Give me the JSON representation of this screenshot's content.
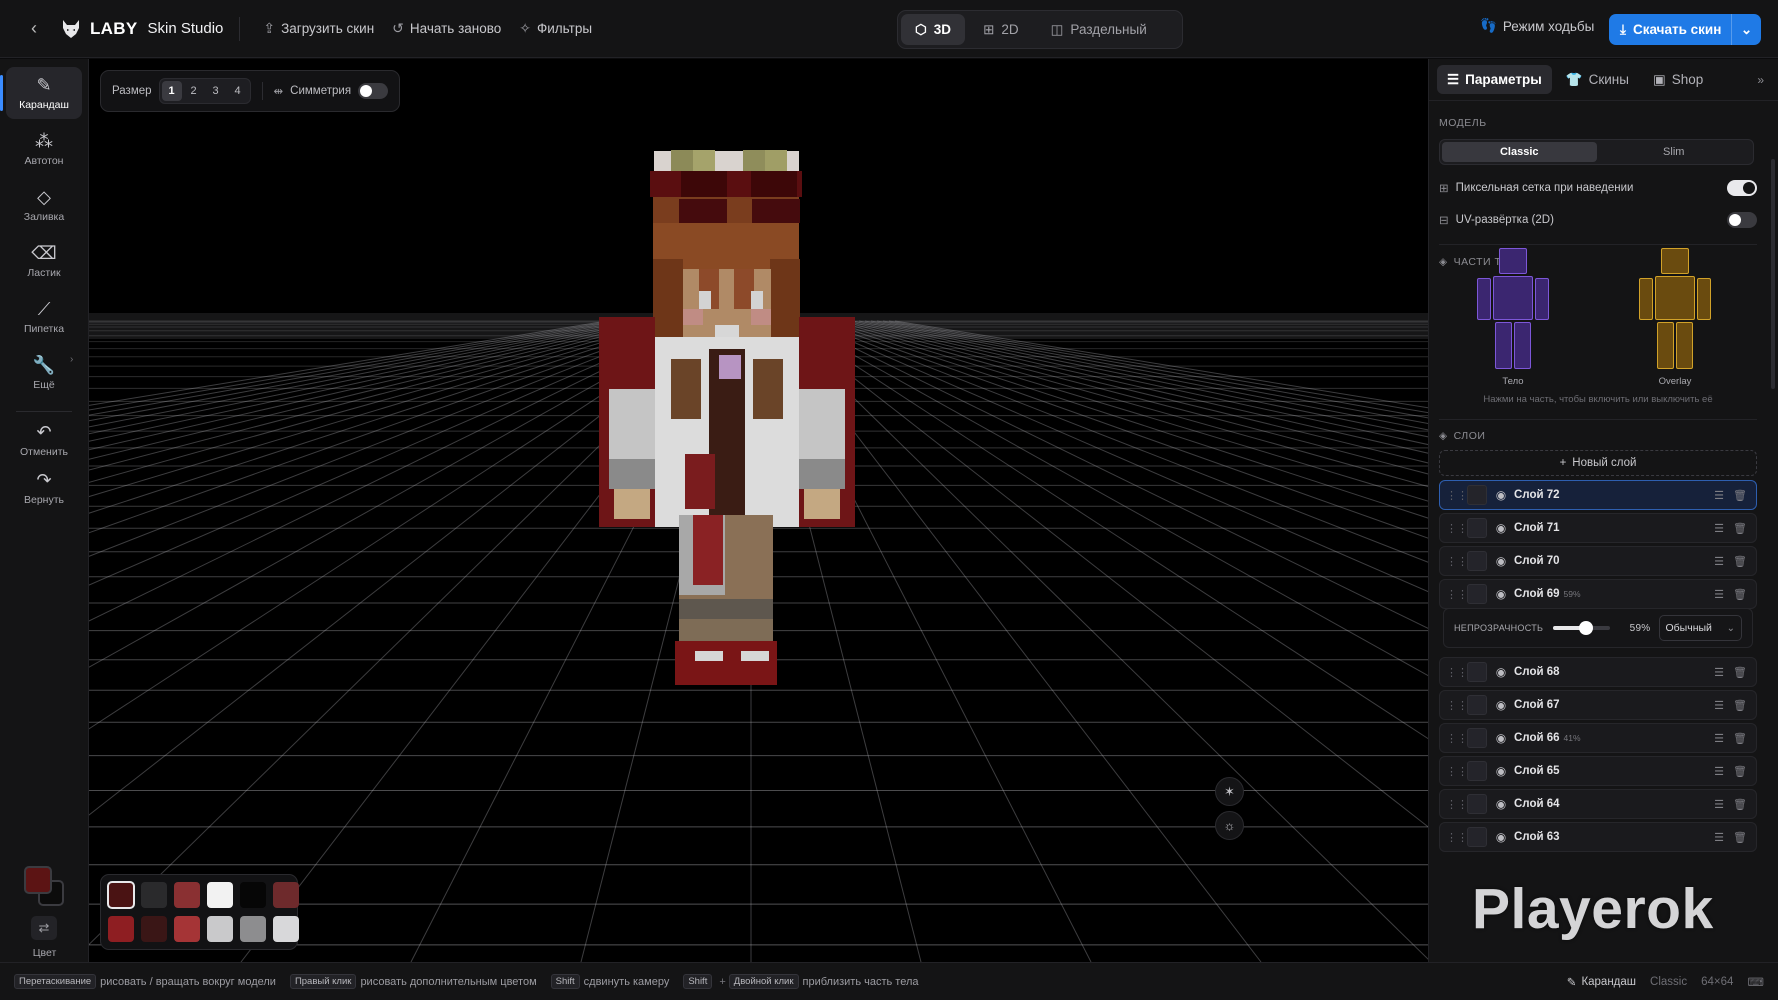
{
  "topbar": {
    "logo_brand": "LABY",
    "logo_sub": "Skin Studio",
    "actions": [
      {
        "label": "Загрузить скин",
        "icon": "upload-icon"
      },
      {
        "label": "Начать заново",
        "icon": "reset-icon"
      },
      {
        "label": "Фильтры",
        "icon": "wand-icon"
      }
    ],
    "views": [
      {
        "label": "3D",
        "icon": "cube-icon",
        "active": true
      },
      {
        "label": "2D",
        "icon": "grid-icon",
        "active": false
      },
      {
        "label": "Раздельный",
        "icon": "split-icon",
        "active": false
      }
    ],
    "walk_mode": "Режим ходьбы",
    "download": "Скачать скин"
  },
  "tools": [
    {
      "label": "Карандаш",
      "icon": "pencil-icon",
      "active": true
    },
    {
      "label": "Автотон",
      "icon": "spray-icon"
    },
    {
      "label": "Заливка",
      "icon": "bucket-icon"
    },
    {
      "label": "Ластик",
      "icon": "eraser-icon"
    },
    {
      "label": "Пипетка",
      "icon": "eyedropper-icon"
    },
    {
      "label": "Ещё",
      "icon": "wrench-icon"
    },
    {
      "label": "Отменить",
      "icon": "undo-icon"
    },
    {
      "label": "Вернуть",
      "icon": "redo-icon"
    }
  ],
  "color": {
    "label": "Цвет",
    "primary": "#5c1414",
    "secondary": "#0c0c0c"
  },
  "brush": {
    "size_label": "Размер",
    "sizes": [
      "1",
      "2",
      "3",
      "4"
    ],
    "active_size": "1",
    "symmetry_label": "Симметрия",
    "symmetry_on": false
  },
  "palette": [
    "#4a1313",
    "#2a2a2c",
    "#8a3032",
    "#f2f2f2",
    "#060606",
    "#6e2a2c",
    "#8e1e22",
    "#3a1616",
    "#a53436",
    "#c9c9cb",
    "#8d8d8f",
    "#d8d8da"
  ],
  "right_panel": {
    "tabs": [
      {
        "label": "Параметры",
        "icon": "sliders-icon",
        "active": true
      },
      {
        "label": "Скины",
        "icon": "shirt-icon",
        "active": false
      },
      {
        "label": "Shop",
        "icon": "shop-icon",
        "active": false
      }
    ],
    "model_title": "МОДЕЛЬ",
    "model_options": [
      "Classic",
      "Slim"
    ],
    "model_active": "Classic",
    "pixel_grid_label": "Пиксельная сетка при наведении",
    "pixel_grid_on": true,
    "uv_label": "UV-развёртка (2D)",
    "uv_on": false,
    "body_parts_title": "ЧАСТИ ТЕЛА",
    "body_label": "Тело",
    "overlay_label": "Overlay",
    "body_parts_hint": "Нажми на часть, чтобы включить или выключить её",
    "layers_title": "СЛОИ",
    "new_layer": "Новый слой",
    "layers": [
      {
        "name": "Слой 72",
        "pct": "",
        "selected": true
      },
      {
        "name": "Слой 71",
        "pct": ""
      },
      {
        "name": "Слой 70",
        "pct": ""
      },
      {
        "name": "Слой 69",
        "pct": "59%"
      },
      {
        "name": "Слой 68",
        "pct": ""
      },
      {
        "name": "Слой 67",
        "pct": ""
      },
      {
        "name": "Слой 66",
        "pct": "41%"
      },
      {
        "name": "Слой 65",
        "pct": ""
      },
      {
        "name": "Слой 64",
        "pct": ""
      },
      {
        "name": "Слой 63",
        "pct": ""
      }
    ],
    "opacity_label": "НЕПРОЗРАЧНОСТЬ",
    "opacity_value": "59%",
    "opacity_fraction": 0.59,
    "blend_mode": "Обычный"
  },
  "watermark": "Playerok",
  "status": {
    "hints": [
      {
        "keys": [
          "Перетаскивание"
        ],
        "text": "рисовать / вращать вокруг модели"
      },
      {
        "keys": [
          "Правый клик"
        ],
        "text": "рисовать дополнительным цветом"
      },
      {
        "keys": [
          "Shift"
        ],
        "text": "сдвинуть камеру"
      },
      {
        "keys": [
          "Shift",
          "Двойной клик"
        ],
        "text": "приблизить часть тела"
      }
    ],
    "current_tool": "Карандаш",
    "model": "Classic",
    "resolution": "64×64"
  }
}
